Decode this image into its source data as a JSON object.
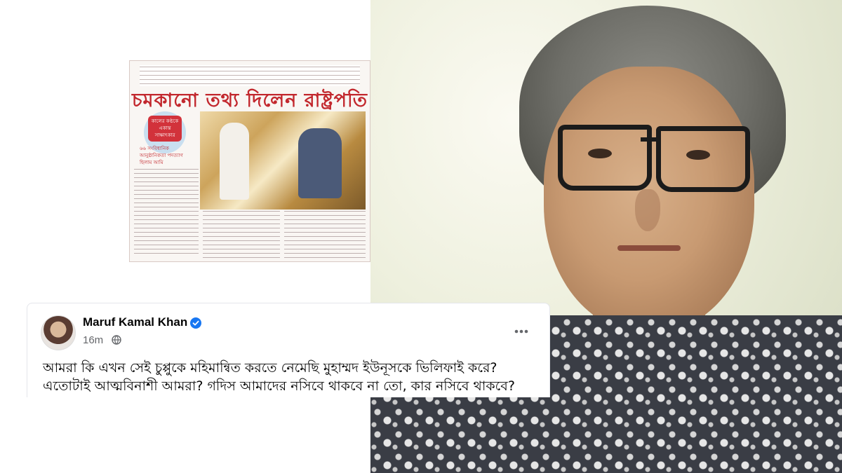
{
  "post": {
    "author": "Maruf Kamal Khan",
    "time": "16m",
    "text_line1": "আমরা কি এখন সেই চুপ্পুকে মহিমান্বিত করতে নেমেছি মুহাম্মদ ইউনূসকে ভিলিফাই করে?",
    "text_line2": "এতোটাই আত্মবিনাশী আমরা? গদিস আমাদের নসিবে থাকবে না তো, কার নসিবে থাকবে?"
  },
  "newspaper": {
    "headline": "চমকানো তথ্য দিলেন রাষ্ট্রপতি",
    "badge_text": "কালের কণ্ঠকে একান্ত সাক্ষাৎকার",
    "quote_text": "৬৬ সংবিধানিক আনুষ্ঠানিকতা পদত্যাগ ছিলাম আমি"
  },
  "icons": {
    "verified": "verified-badge-icon",
    "audience": "globe-icon",
    "more": "more-options-icon"
  },
  "colors": {
    "headline_red": "#c2272d",
    "verified_blue": "#1877f2",
    "meta_gray": "#65676b"
  }
}
